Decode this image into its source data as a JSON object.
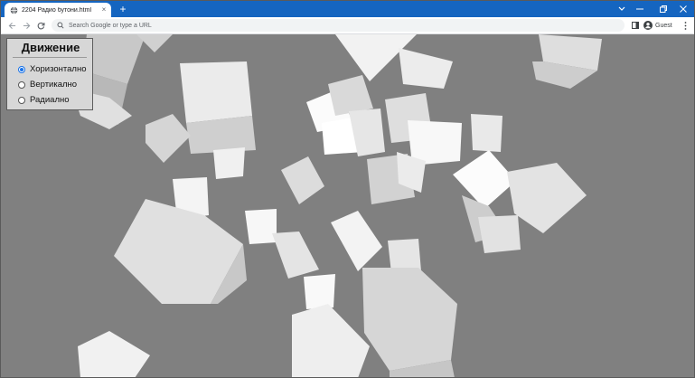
{
  "browser": {
    "tab_title": "2204 Радио бутони.html",
    "tab_close": "×",
    "new_tab": "+",
    "address_placeholder": "Search Google or type a URL",
    "profile_label": "Guest"
  },
  "panel": {
    "title": "Движение",
    "options": [
      {
        "label": "Хоризонтално",
        "checked": true
      },
      {
        "label": "Вертикално",
        "checked": false
      },
      {
        "label": "Радиално",
        "checked": false
      }
    ]
  },
  "colors": {
    "tabbar": "#1565c0",
    "scene_background": "#808080",
    "radio_accent": "#1a73e8"
  }
}
